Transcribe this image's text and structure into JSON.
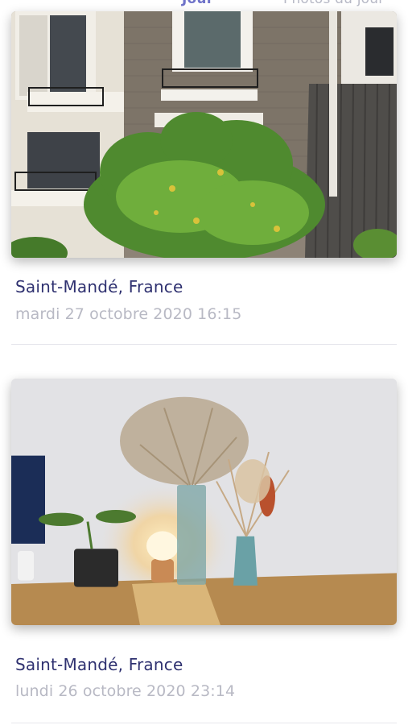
{
  "header": {
    "tabs": [
      {
        "label": "Jour",
        "active": true
      },
      {
        "label": "Photos du jour",
        "active": false
      }
    ]
  },
  "feed": {
    "items": [
      {
        "location": "Saint-Mandé, France",
        "date": "mardi 27 octobre 2020 16:15",
        "image": "building-courtyard-tree-photo"
      },
      {
        "location": "Saint-Mandé, France",
        "date": "lundi 26 octobre 2020 23:14",
        "image": "dried-flowers-lamp-desk-photo"
      }
    ]
  },
  "colors": {
    "title": "#2f3170",
    "date": "#b8b9c4",
    "active_tab": "#6f73c9",
    "divider": "#e6e6ec"
  }
}
